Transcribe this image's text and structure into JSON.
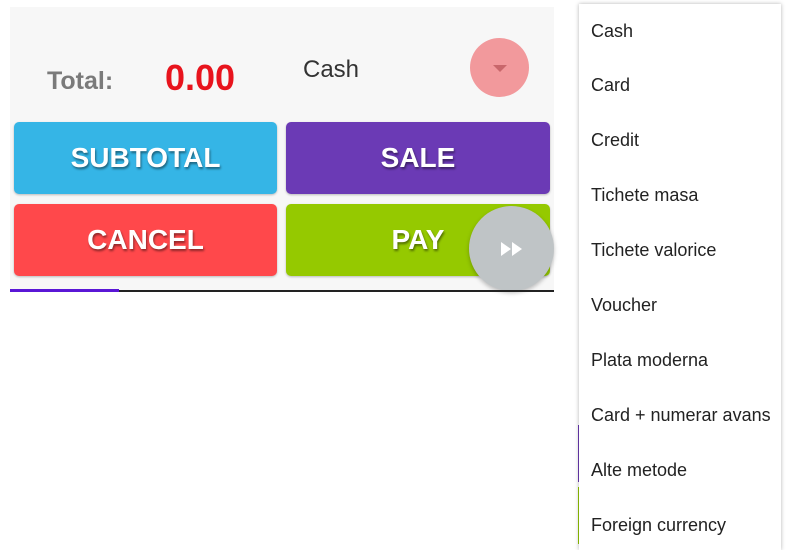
{
  "total": {
    "label": "Total:",
    "value": "0.00"
  },
  "payment": {
    "selected": "Cash"
  },
  "buttons": {
    "subtotal": "SUBTOTAL",
    "sale": "SALE",
    "cancel": "CANCEL",
    "pay": "PAY"
  },
  "icons": {
    "dropdown": "chevron-down-icon",
    "forward": "fast-forward-icon"
  },
  "progress": {
    "fraction": 0.2
  },
  "dropdown_options": [
    "Cash",
    "Card",
    "Credit",
    "Tichete masa",
    "Tichete valorice",
    "Voucher",
    "Plata moderna",
    "Card + numerar avans",
    "Alte metode",
    "Foreign currency"
  ],
  "colors": {
    "total_value": "#e8141d",
    "subtotal": "#35b5e6",
    "sale": "#6b3ab5",
    "cancel": "#ff484b",
    "pay": "#95c900",
    "dropdown_button": "#f2999c",
    "forward_button": "#bfc4c6",
    "progress": "#5a16d6"
  }
}
